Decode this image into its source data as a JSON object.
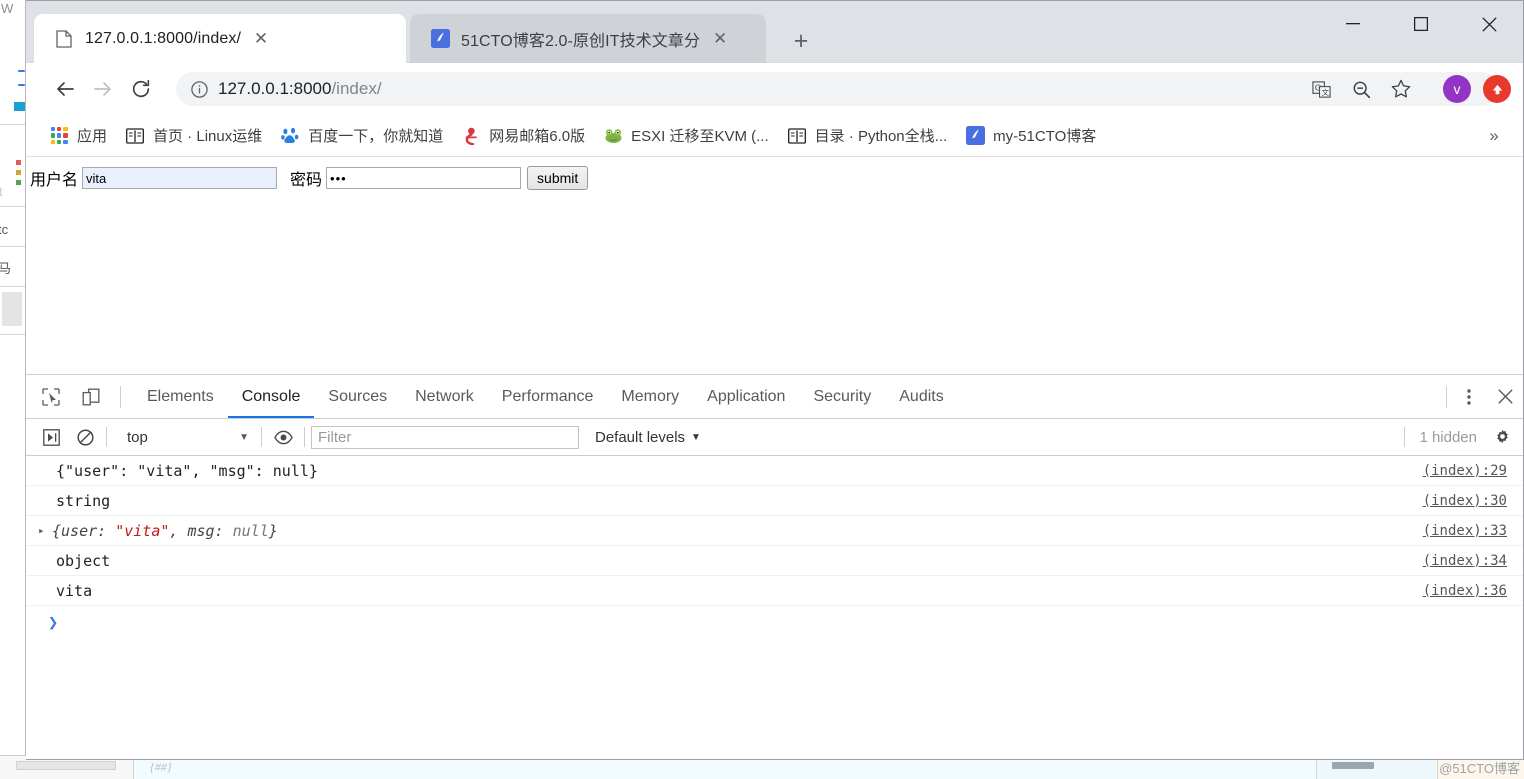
{
  "window": {
    "controls": {
      "minimize": "—",
      "maximize": "□",
      "close": "✕"
    }
  },
  "tabs": [
    {
      "title": "127.0.0.1:8000/index/",
      "favicon": "page-icon",
      "active": true,
      "close": "✕"
    },
    {
      "title": "51CTO博客2.0-原创IT技术文章分",
      "favicon": "51cto-icon",
      "active": false,
      "close": "✕"
    }
  ],
  "newtab_label": "+",
  "omnibox": {
    "url_main": "127.0.0.1:8000",
    "url_path": "/index/",
    "security_icon": "info-circle-icon",
    "actions": [
      "translate-icon",
      "zoom-out-icon",
      "star-icon"
    ],
    "avatar_letter": "v",
    "update_icon": "update-arrow-icon"
  },
  "bookmarks": {
    "items": [
      {
        "label": "应用",
        "icon": "apps-grid-icon"
      },
      {
        "label": "首页 · Linux运维",
        "icon": "book-icon"
      },
      {
        "label": "百度一下，你就知道",
        "icon": "baidu-icon"
      },
      {
        "label": "网易邮箱6.0版",
        "icon": "netease-icon"
      },
      {
        "label": "ESXI 迁移至KVM (...",
        "icon": "frog-icon"
      },
      {
        "label": "目录 · Python全栈...",
        "icon": "book-icon"
      },
      {
        "label": "my-51CTO博客",
        "icon": "51cto-icon"
      }
    ],
    "overflow": "»"
  },
  "page": {
    "username_label": "用户名",
    "username_value": "vita",
    "password_label": "密码",
    "password_value": "•••",
    "submit_label": "submit"
  },
  "devtools": {
    "tabs": [
      {
        "label": "Elements",
        "active": false
      },
      {
        "label": "Console",
        "active": true
      },
      {
        "label": "Sources",
        "active": false
      },
      {
        "label": "Network",
        "active": false
      },
      {
        "label": "Performance",
        "active": false
      },
      {
        "label": "Memory",
        "active": false
      },
      {
        "label": "Application",
        "active": false
      },
      {
        "label": "Security",
        "active": false
      },
      {
        "label": "Audits",
        "active": false
      }
    ],
    "inspect_icon": "inspect-cursor-icon",
    "device_icon": "device-toggle-icon",
    "menu_icon": "kebab-menu-icon",
    "close_icon": "close-icon",
    "console": {
      "execute_icon": "execution-context-icon",
      "clear_icon": "clear-console-icon",
      "context": "top",
      "eye_icon": "live-expression-icon",
      "filter_placeholder": "Filter",
      "filter_value": "",
      "levels": "Default levels",
      "hidden_count": "1 hidden",
      "settings_icon": "gear-icon",
      "prompt": "❯",
      "messages": [
        {
          "kind": "text",
          "text": "{\"user\": \"vita\", \"msg\": null}",
          "source": "(index):29"
        },
        {
          "kind": "text",
          "text": "string",
          "source": "(index):30"
        },
        {
          "kind": "object",
          "arrow": "▸",
          "pre": "{user: ",
          "str": "\"vita\"",
          "mid": ", msg: ",
          "nul": "null",
          "post": "}",
          "source": "(index):33"
        },
        {
          "kind": "text",
          "text": "object",
          "source": "(index):34"
        },
        {
          "kind": "text",
          "text": "vita",
          "source": "(index):36"
        }
      ]
    }
  },
  "background": {
    "left_fragments": [
      "W",
      "t",
      "tc",
      "马"
    ],
    "bottom_fragment": "{##}"
  },
  "watermark": "@51CTO博客",
  "colors": {
    "accent": "#1a73e8",
    "tabstrip": "#dee1e6",
    "autofill": "#e8f0fe",
    "avatar": "#9334c6",
    "update": "#e8392d",
    "string_red": "#c41a16"
  }
}
